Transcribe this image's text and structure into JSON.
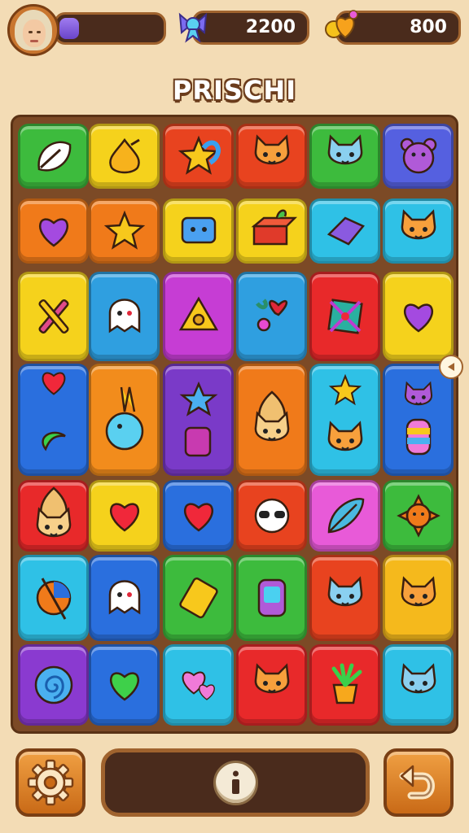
{
  "player": {
    "avatar_icon": "player-avatar",
    "xp_progress": 0.19
  },
  "currencies": [
    {
      "icon": "ribbon-gem-icon",
      "value": "2200"
    },
    {
      "icon": "heart-coin-icon",
      "value": "800"
    }
  ],
  "title": "PRISCHI",
  "board": {
    "rows": [
      [
        {
          "color": "#3dbb3d",
          "icon": "leaf-swirl-icon"
        },
        {
          "color": "#f5d21c",
          "icon": "onion-icon"
        },
        {
          "color": "#e8431f",
          "icon": "star-swirl-icon"
        },
        {
          "color": "#e8431f",
          "icon": "cat-face-icon"
        },
        {
          "color": "#3dbb3d",
          "icon": "cat-icon"
        },
        {
          "color": "#5560e0",
          "icon": "bear-icon"
        }
      ],
      [
        {
          "color": "#f07a1a",
          "icon": "heart-bow-icon"
        },
        {
          "color": "#f07a1a",
          "icon": "star-icon"
        },
        {
          "color": "#f5d21c",
          "icon": "robot-box-icon"
        },
        {
          "color": "#f5d21c",
          "icon": "gift-box-icon"
        },
        {
          "color": "#2fc1e6",
          "icon": "purple-gem-icon"
        },
        {
          "color": "#2fc1e6",
          "icon": "cat-face-icon"
        }
      ],
      [
        {
          "color": "#f5d21c",
          "icon": "crossed-tools-icon"
        },
        {
          "color": "#2f9fe0",
          "icon": "ghost-cat-icon"
        },
        {
          "color": "#c63dd4",
          "icon": "cheese-icon"
        },
        {
          "color": "#2f9fe0",
          "icon": "candy-mix-icon"
        },
        {
          "color": "#e8292a",
          "icon": "diamond-icon"
        },
        {
          "color": "#f5d21c",
          "icon": "purple-heart-icon"
        }
      ],
      [
        {
          "color": "#2a6fde",
          "icon": "heart-swirl-icon",
          "tall": true
        },
        {
          "color": "#f28c1c",
          "icon": "bird-orb-icon",
          "tall": true
        },
        {
          "color": "#7a3ac8",
          "icon": "star-jar-icon",
          "tall": true
        },
        {
          "color": "#f07a1a",
          "icon": "lion-icon",
          "tall": true
        },
        {
          "color": "#2fc1e6",
          "icon": "star-cat-icon",
          "tall": true
        },
        {
          "color": "#2a6fde",
          "icon": "rainbow-cat-icon",
          "tall": true
        }
      ],
      [
        {
          "color": "#e8292a",
          "icon": "lion-cub-icon"
        },
        {
          "color": "#f5d21c",
          "icon": "red-heart-icon"
        },
        {
          "color": "#2a6fde",
          "icon": "red-heart-icon"
        },
        {
          "color": "#e8431f",
          "icon": "panda-icon"
        },
        {
          "color": "#e85ad8",
          "icon": "feather-icon"
        },
        {
          "color": "#3dbb3d",
          "icon": "sun-icon"
        }
      ],
      [
        {
          "color": "#2fc1e6",
          "icon": "pie-icon"
        },
        {
          "color": "#2a6fde",
          "icon": "ghost-icon"
        },
        {
          "color": "#3dbb3d",
          "icon": "gold-bar-icon"
        },
        {
          "color": "#3dbb3d",
          "icon": "phone-icon"
        },
        {
          "color": "#e8431f",
          "icon": "cat-icon"
        },
        {
          "color": "#f5b91c",
          "icon": "cat-face-icon"
        }
      ],
      [
        {
          "color": "#8a3ad0",
          "icon": "spiral-icon"
        },
        {
          "color": "#2a6fde",
          "icon": "green-heart-icon"
        },
        {
          "color": "#2fc1e6",
          "icon": "pink-hearts-icon"
        },
        {
          "color": "#e8292a",
          "icon": "cat-face-icon"
        },
        {
          "color": "#e8292a",
          "icon": "potted-plant-icon"
        },
        {
          "color": "#2fc1e6",
          "icon": "cat-icon"
        }
      ]
    ]
  },
  "controls": {
    "settings_icon": "gear-icon",
    "info_icon": "info-icon",
    "undo_icon": "undo-icon"
  }
}
